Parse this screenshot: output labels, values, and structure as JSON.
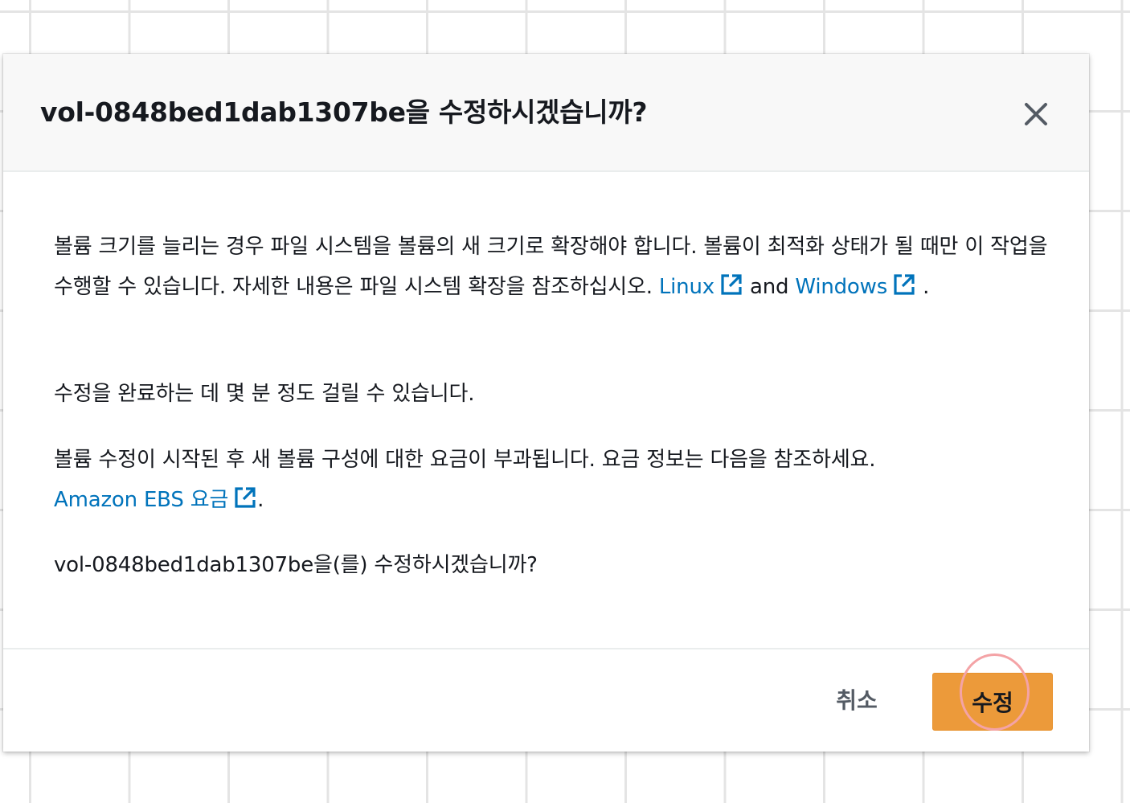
{
  "modal": {
    "title": "vol-0848bed1dab1307be을 수정하시겠습니까?",
    "body": {
      "paragraph1": {
        "text": "볼륨 크기를 늘리는 경우 파일 시스템을 볼륨의 새 크기로 확장해야 합니다. 볼륨이 최적화 상태가 될 때만 이 작업을 수행할 수 있습니다. 자세한 내용은 파일 시스템 확장을 참조하십시오. ",
        "link_linux": "Linux",
        "connector": " and ",
        "link_windows": "Windows",
        "ending": " ."
      },
      "paragraph2": "수정을 완료하는 데 몇 분 정도 걸릴 수 있습니다.",
      "paragraph3": {
        "text": "볼륨 수정이 시작된 후 새 볼륨 구성에 대한 요금이 부과됩니다. 요금 정보는 다음을 참조하세요. ",
        "link_pricing": "Amazon EBS 요금",
        "ending": "."
      },
      "paragraph4": "vol-0848bed1dab1307be을(를) 수정하시겠습니까?"
    },
    "footer": {
      "cancel_label": "취소",
      "confirm_label": "수정"
    }
  },
  "icons": {
    "close": "close-icon",
    "external_link": "external-link-icon"
  },
  "colors": {
    "link": "#0073bb",
    "primary_button": "#ec9a3a",
    "header_background": "#f8f8f8",
    "text": "#16191f",
    "click_indicator": "#f4a3a6"
  }
}
